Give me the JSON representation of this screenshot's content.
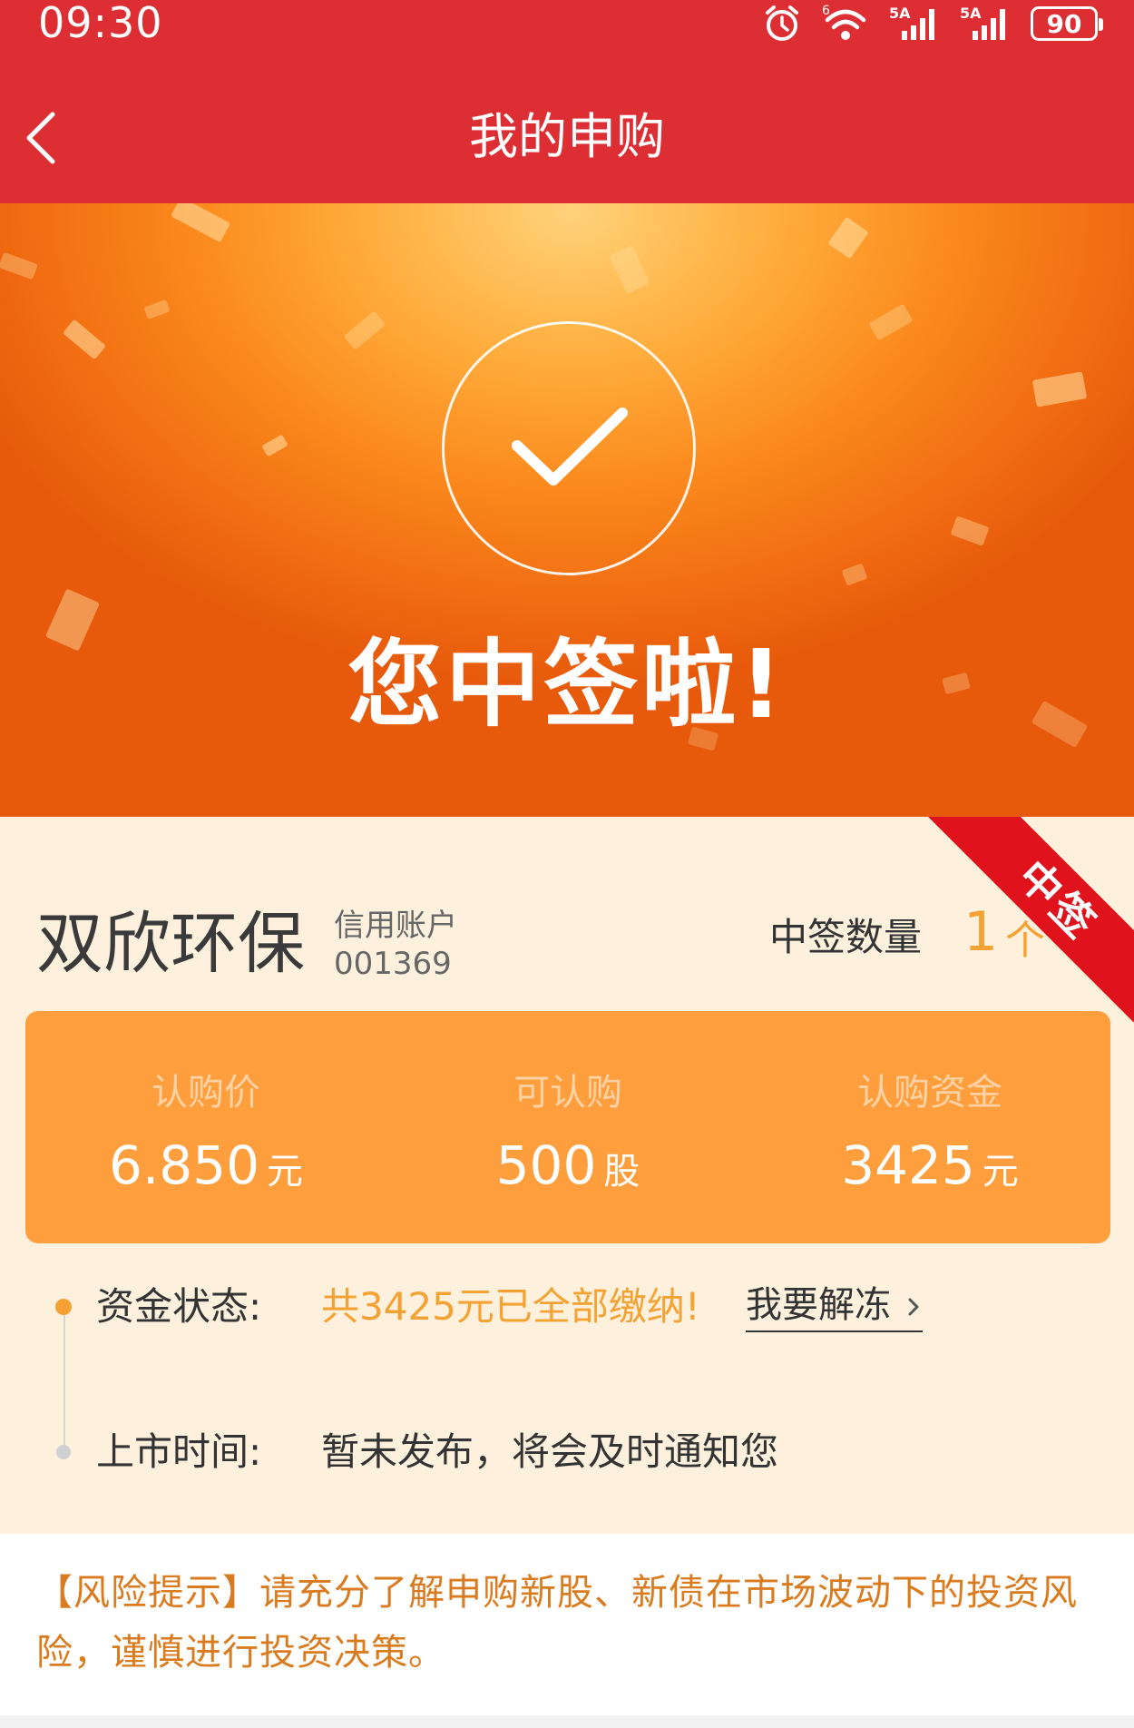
{
  "status_bar": {
    "time": "09:30",
    "battery": "90",
    "icons": [
      "alarm-icon",
      "wifi-icon",
      "signal-5a-icon",
      "signal-5a-icon",
      "battery-icon"
    ]
  },
  "nav": {
    "title": "我的申购",
    "back_icon": "chevron-left-icon"
  },
  "banner": {
    "title": "您中签啦!",
    "icon": "check-circle-icon"
  },
  "card": {
    "ribbon": "中签",
    "stock_name": "双欣环保",
    "account_type": "信用账户",
    "account_no": "001369",
    "win_label": "中签数量",
    "win_count": "1",
    "win_unit": "个",
    "price": {
      "label": "认购价",
      "value": "6.850",
      "unit": "元"
    },
    "available": {
      "label": "可认购",
      "value": "500",
      "unit": "股"
    },
    "funds": {
      "label": "认购资金",
      "value": "3425",
      "unit": "元"
    },
    "fund_status_label": "资金状态:",
    "fund_status_value": "共3425元已全部缴纳!",
    "unfreeze_label": "我要解冻",
    "listing_label": "上市时间:",
    "listing_value": "暂未发布，将会及时通知您"
  },
  "risk": {
    "text": "【风险提示】请充分了解申购新股、新债在市场波动下的投资风险，谨慎进行投资决策。"
  },
  "colors": {
    "header_red": "#dd2e33",
    "accent_orange": "#f5a235",
    "price_box": "#fe9e3d",
    "ribbon_red": "#e0131d",
    "card_bg": "#fdf1dd",
    "risk_text": "#d97b1e"
  }
}
